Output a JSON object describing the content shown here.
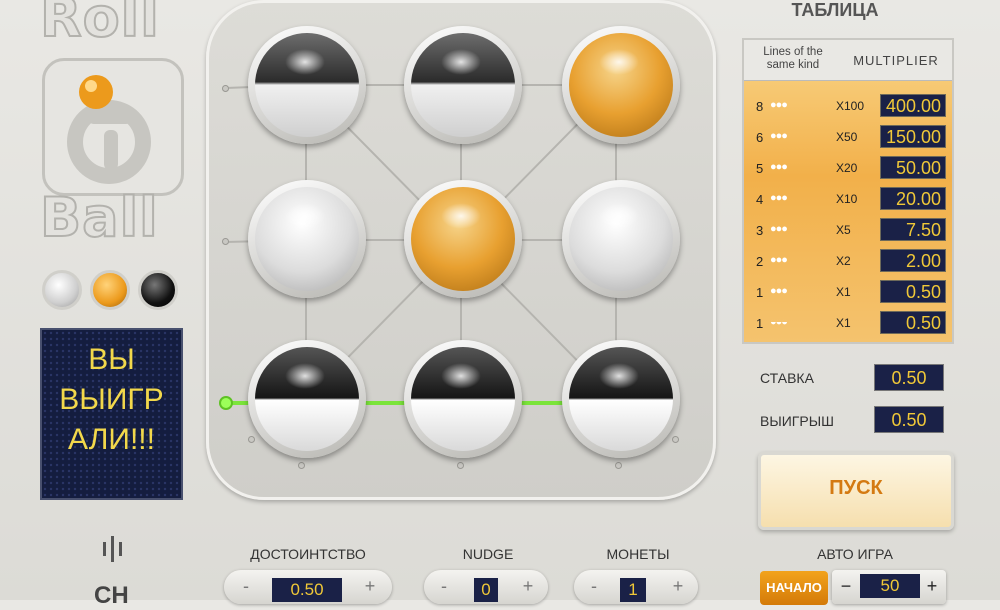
{
  "logo": {
    "word_top": "Roll",
    "letter_mid": "a",
    "word_bottom": "Ball"
  },
  "message": {
    "line1": "ВЫ",
    "line2": "ВЫИГР",
    "line3": "АЛИ!!!"
  },
  "board": {
    "cells": [
      {
        "name": "cell-1-1",
        "type": "half"
      },
      {
        "name": "cell-1-2",
        "type": "half"
      },
      {
        "name": "cell-1-3",
        "type": "orange"
      },
      {
        "name": "cell-2-1",
        "type": "white"
      },
      {
        "name": "cell-2-2",
        "type": "orange"
      },
      {
        "name": "cell-2-3",
        "type": "white"
      },
      {
        "name": "cell-3-1",
        "type": "half2"
      },
      {
        "name": "cell-3-2",
        "type": "half2"
      },
      {
        "name": "cell-3-3",
        "type": "half2"
      }
    ],
    "winning_line_color": "#7be43a"
  },
  "paytable": {
    "title": "ТАБЛИЦА",
    "header_lines": "Lines of the same kind",
    "header_multiplier": "MULTIPLIER",
    "rows": [
      {
        "lines": "8",
        "dots": "●●●",
        "mult": "X100",
        "value": "400.00"
      },
      {
        "lines": "6",
        "dots": "●●●",
        "mult": "X50",
        "value": "150.00"
      },
      {
        "lines": "5",
        "dots": "●●●",
        "mult": "X20",
        "value": "50.00"
      },
      {
        "lines": "4",
        "dots": "●●●",
        "mult": "X10",
        "value": "20.00"
      },
      {
        "lines": "3",
        "dots": "●●●",
        "mult": "X5",
        "value": "7.50"
      },
      {
        "lines": "2",
        "dots": "●●●",
        "mult": "X2",
        "value": "2.00"
      },
      {
        "lines": "1",
        "dots": "●●●",
        "mult": "X1",
        "value": "0.50"
      },
      {
        "lines": "1",
        "dots": "◒◒◒",
        "mult": "X1",
        "value": "0.50"
      }
    ]
  },
  "bet": {
    "label": "СТАВКА",
    "value": "0.50"
  },
  "win": {
    "label": "ВЫИГРЫШ",
    "value": "0.50"
  },
  "spin_label": "ПУСК",
  "controls": {
    "denomination": {
      "label": "ДОСТОИНТСТВО",
      "value": "0.50",
      "minus": "-",
      "plus": "+"
    },
    "nudge": {
      "label": "NUDGE",
      "value": "0",
      "minus": "-",
      "plus": "+"
    },
    "coins": {
      "label": "МОНЕТЫ",
      "value": "1",
      "minus": "-",
      "plus": "+"
    },
    "auto": {
      "label": "АВТО ИГРА",
      "start": "НАЧАЛО",
      "value": "50",
      "minus": "−",
      "plus": "+"
    }
  },
  "footer_left": "CH",
  "icon_names": [
    "sound-bars-icon"
  ]
}
